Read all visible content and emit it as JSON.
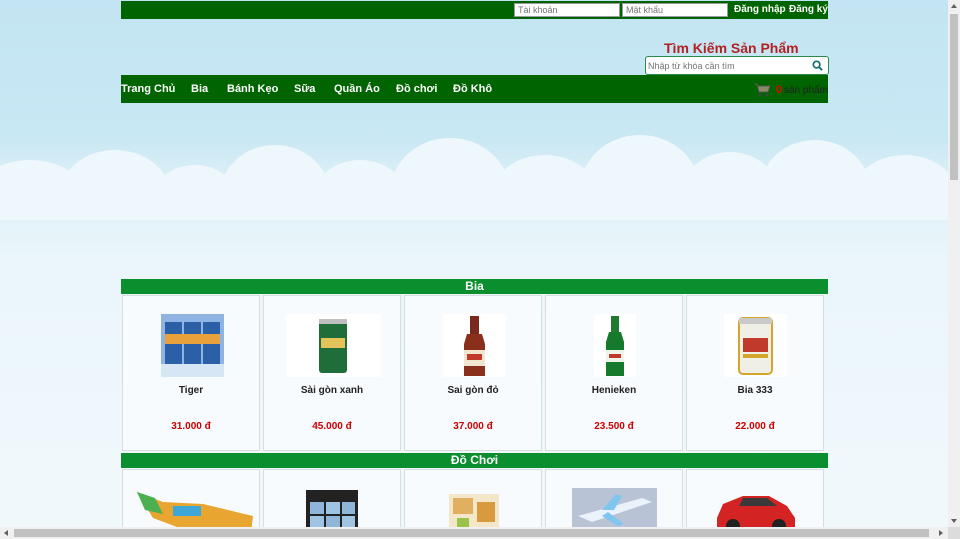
{
  "topbar": {
    "username_placeholder": "Tài khoản",
    "password_placeholder": "Mật khẩu",
    "login_label": "Đăng nhập",
    "register_label": "Đăng ký"
  },
  "search": {
    "title": "Tìm Kiếm Sản Phẩm",
    "placeholder": "Nhập từ khóa cần tìm",
    "icon": "search-icon"
  },
  "nav": {
    "items": [
      "Trang Chủ",
      "Bia",
      "Bánh Kẹo",
      "Sữa",
      "Quần Áo",
      "Đồ chơi",
      "Đồ Khô"
    ]
  },
  "cart": {
    "count": "0",
    "label": "sản phẩm",
    "icon": "cart-icon"
  },
  "sections": [
    {
      "title": "Bia",
      "products": [
        {
          "name": "Tiger",
          "price": "31.000 đ"
        },
        {
          "name": "Sài gòn xanh",
          "price": "45.000 đ"
        },
        {
          "name": "Sai gòn đỏ",
          "price": "37.000 đ"
        },
        {
          "name": "Henieken",
          "price": "23.500 đ"
        },
        {
          "name": "Bia 333",
          "price": "22.000 đ"
        }
      ]
    },
    {
      "title": "Đồ Chơi",
      "products": [
        {
          "name": "",
          "price": ""
        },
        {
          "name": "",
          "price": ""
        },
        {
          "name": "",
          "price": ""
        },
        {
          "name": "",
          "price": ""
        },
        {
          "name": "",
          "price": ""
        }
      ]
    }
  ],
  "colors": {
    "header_green": "#006400",
    "section_green": "#0b8e2e",
    "price_red": "#cc0000",
    "search_title_red": "#b22222"
  }
}
